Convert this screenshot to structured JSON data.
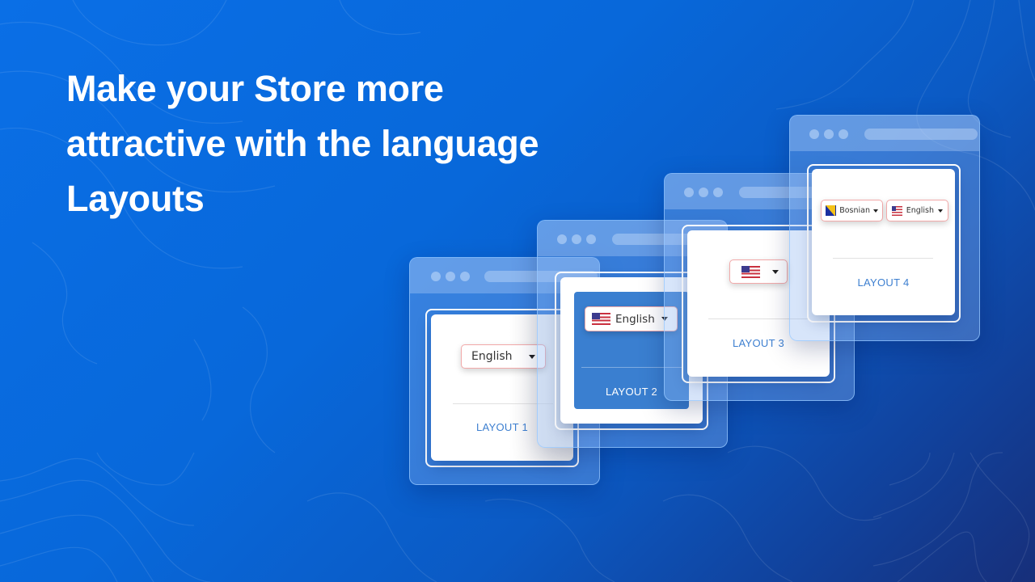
{
  "headline": {
    "lines": [
      "Make your Store more",
      "attractive with the language",
      "Layouts"
    ]
  },
  "colors": {
    "background_start": "#0a6fe6",
    "background_end": "#172f7a",
    "layout_label": "#3d7fd0",
    "layout2_panel": "#3a7fd0",
    "dropdown_border": "#f2a9a9"
  },
  "layouts": [
    {
      "label": "LAYOUT 1",
      "dropdowns": [
        {
          "text": "English",
          "flag": null,
          "icon": "caret-down-icon"
        }
      ]
    },
    {
      "label": "LAYOUT 2",
      "dropdowns": [
        {
          "text": "English",
          "flag": "us-flag-icon",
          "icon": "caret-down-icon"
        }
      ]
    },
    {
      "label": "LAYOUT 3",
      "dropdowns": [
        {
          "text": "",
          "flag": "us-flag-icon",
          "icon": "caret-down-icon"
        }
      ]
    },
    {
      "label": "LAYOUT 4",
      "dropdowns": [
        {
          "text": "Bosnian",
          "flag": "bosnia-flag-icon",
          "icon": "caret-down-icon"
        },
        {
          "text": "English",
          "flag": "us-flag-icon",
          "icon": "caret-down-icon"
        }
      ]
    }
  ]
}
